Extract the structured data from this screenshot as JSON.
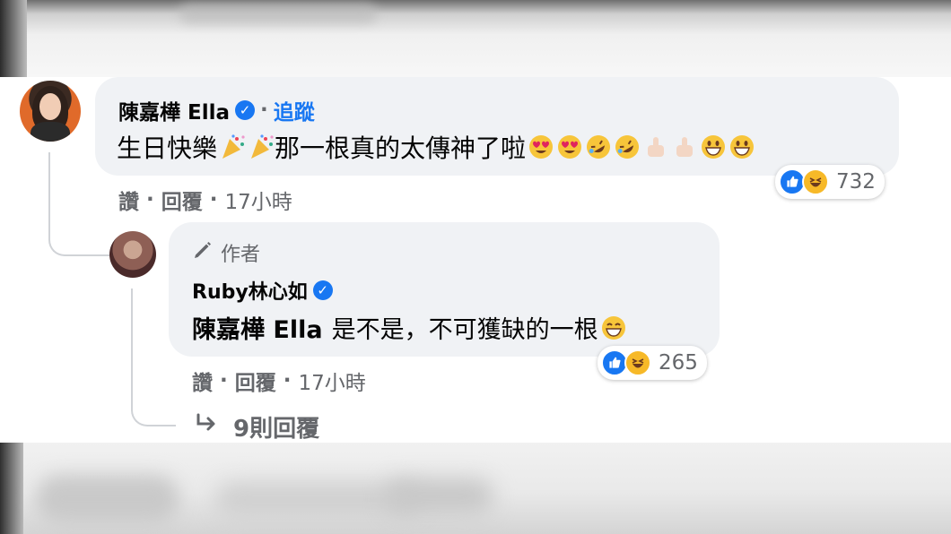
{
  "comment1": {
    "author": "陳嘉樺 Ella",
    "separator": "·",
    "follow_label": "追蹤",
    "text_part1": "生日快樂",
    "text_part2": "那一根真的太傳神了啦",
    "reaction_count": "732",
    "actions": {
      "like": "讚",
      "reply": "回覆",
      "dot": "·",
      "time": "17小時"
    }
  },
  "reply1": {
    "badge": "作者",
    "author": "Ruby林心如",
    "mention": "陳嘉樺 Ella",
    "text": "是不是，不可獲缺的一根",
    "reaction_count": "265",
    "actions": {
      "like": "讚",
      "reply": "回覆",
      "dot": "·",
      "time": "17小時"
    }
  },
  "more_replies_label": "9則回覆",
  "colors": {
    "accent": "#1877f2",
    "bubble": "#f0f2f5",
    "muted": "#65676b",
    "haha": "#f7b928"
  },
  "icons": [
    "verified-badge-icon",
    "party-popper-icon",
    "heart-eyes-icon",
    "rofl-icon",
    "thumbs-up-icon",
    "grinning-icon",
    "pencil-icon",
    "like-reaction-icon",
    "haha-reaction-icon",
    "reply-arrow-icon"
  ]
}
